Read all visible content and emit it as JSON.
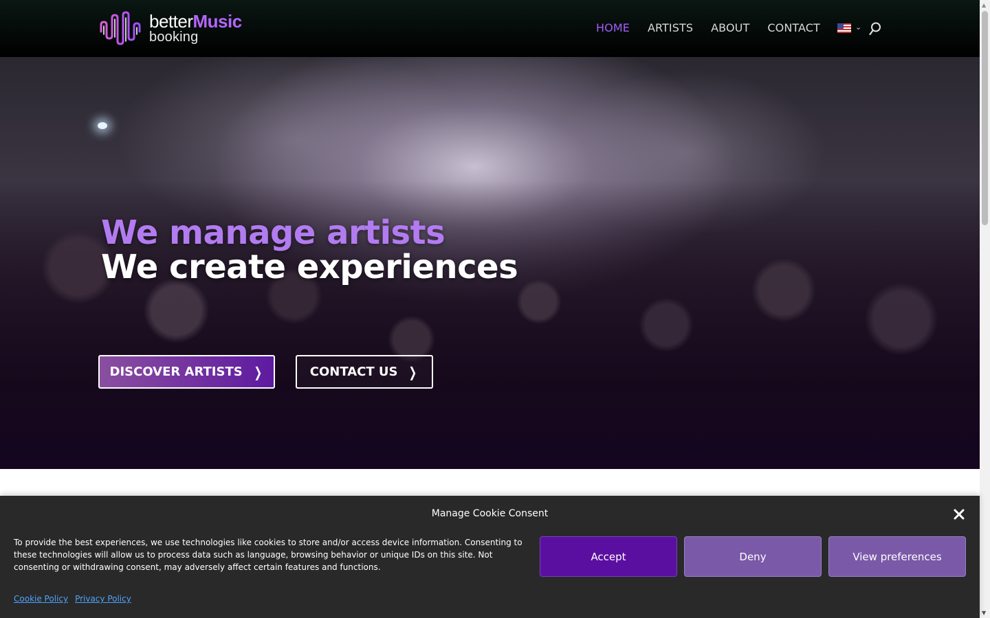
{
  "header": {
    "logo": {
      "word1": "better",
      "word2": "Music",
      "sub": "booking"
    },
    "nav": [
      {
        "label": "HOME",
        "active": true
      },
      {
        "label": "ARTISTS",
        "active": false
      },
      {
        "label": "ABOUT",
        "active": false
      },
      {
        "label": "CONTACT",
        "active": false
      }
    ],
    "language_icon": "us-flag-icon",
    "search_icon": "search-icon"
  },
  "hero": {
    "line1": "We manage artists",
    "line2": "We create experiences",
    "buttons": {
      "discover": "DISCOVER ARTISTS",
      "contact": "CONTACT US"
    }
  },
  "cookie": {
    "title": "Manage Cookie Consent",
    "text": "To provide the best experiences, we use technologies like cookies to store and/or access device information. Consenting to these technologies will allow us to process data such as language, browsing behavior or unique IDs on this site. Not consenting or withdrawing consent, may adversely affect certain features and functions.",
    "accept": "Accept",
    "deny": "Deny",
    "preferences": "View preferences",
    "links": {
      "cookie_policy": "Cookie Policy",
      "privacy_policy": "Privacy Policy"
    }
  },
  "colors": {
    "accent": "#a45cff",
    "accept_bg": "#5b0fa0",
    "deny_bg": "#7a59a8",
    "cookie_bg": "#292929",
    "link": "#4ea3ff"
  }
}
